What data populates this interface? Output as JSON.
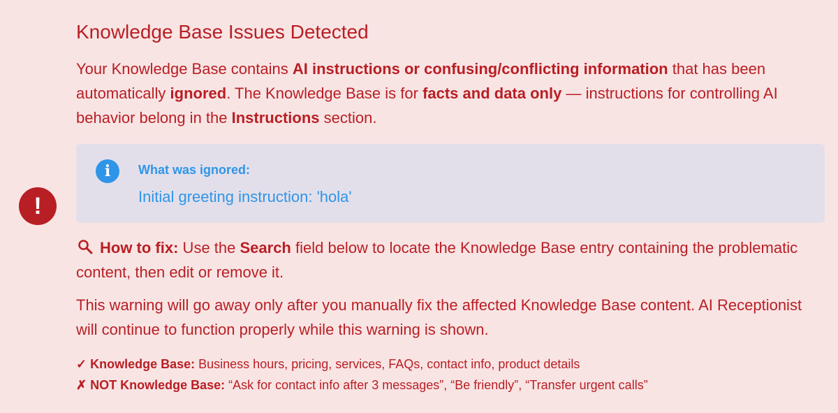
{
  "alert": {
    "icon": "exclamation-icon",
    "glyph": "!"
  },
  "title": "Knowledge Base Issues Detected",
  "intro": {
    "t1": "Your Knowledge Base contains ",
    "b1": "AI instructions or confusing/conflicting information",
    "t2": " that has been automatically ",
    "b2": "ignored",
    "t3": ". The Knowledge Base is for ",
    "b3": "facts and data only",
    "t4": " — instructions for controlling AI behavior belong in the ",
    "b4": "Instructions",
    "t5": " section."
  },
  "info_box": {
    "icon": "info-icon",
    "glyph": "i",
    "title": "What was ignored:",
    "text": "Initial greeting instruction: 'hola'"
  },
  "fix": {
    "icon": "magnifier-icon",
    "label": "How to fix:",
    "t1": " Use the ",
    "b1": "Search",
    "t2": " field below to locate the Knowledge Base entry containing the problematic content, then edit or remove it."
  },
  "warning": "This warning will go away only after you manually fix the affected Knowledge Base content. AI Receptionist will continue to function properly while this warning is shown.",
  "notes": {
    "yes_mark": "✓",
    "yes_label": "Knowledge Base:",
    "yes_text": " Business hours, pricing, services, FAQs, contact info, product details",
    "no_mark": "✗",
    "no_label": "NOT Knowledge Base:",
    "no_text": " “Ask for contact info after 3 messages”, “Be friendly”, “Transfer urgent calls”"
  },
  "colors": {
    "background": "#f9e4e4",
    "text": "#b81f24",
    "info_accent": "#2f95e8",
    "info_bg": "#e3dfea"
  }
}
